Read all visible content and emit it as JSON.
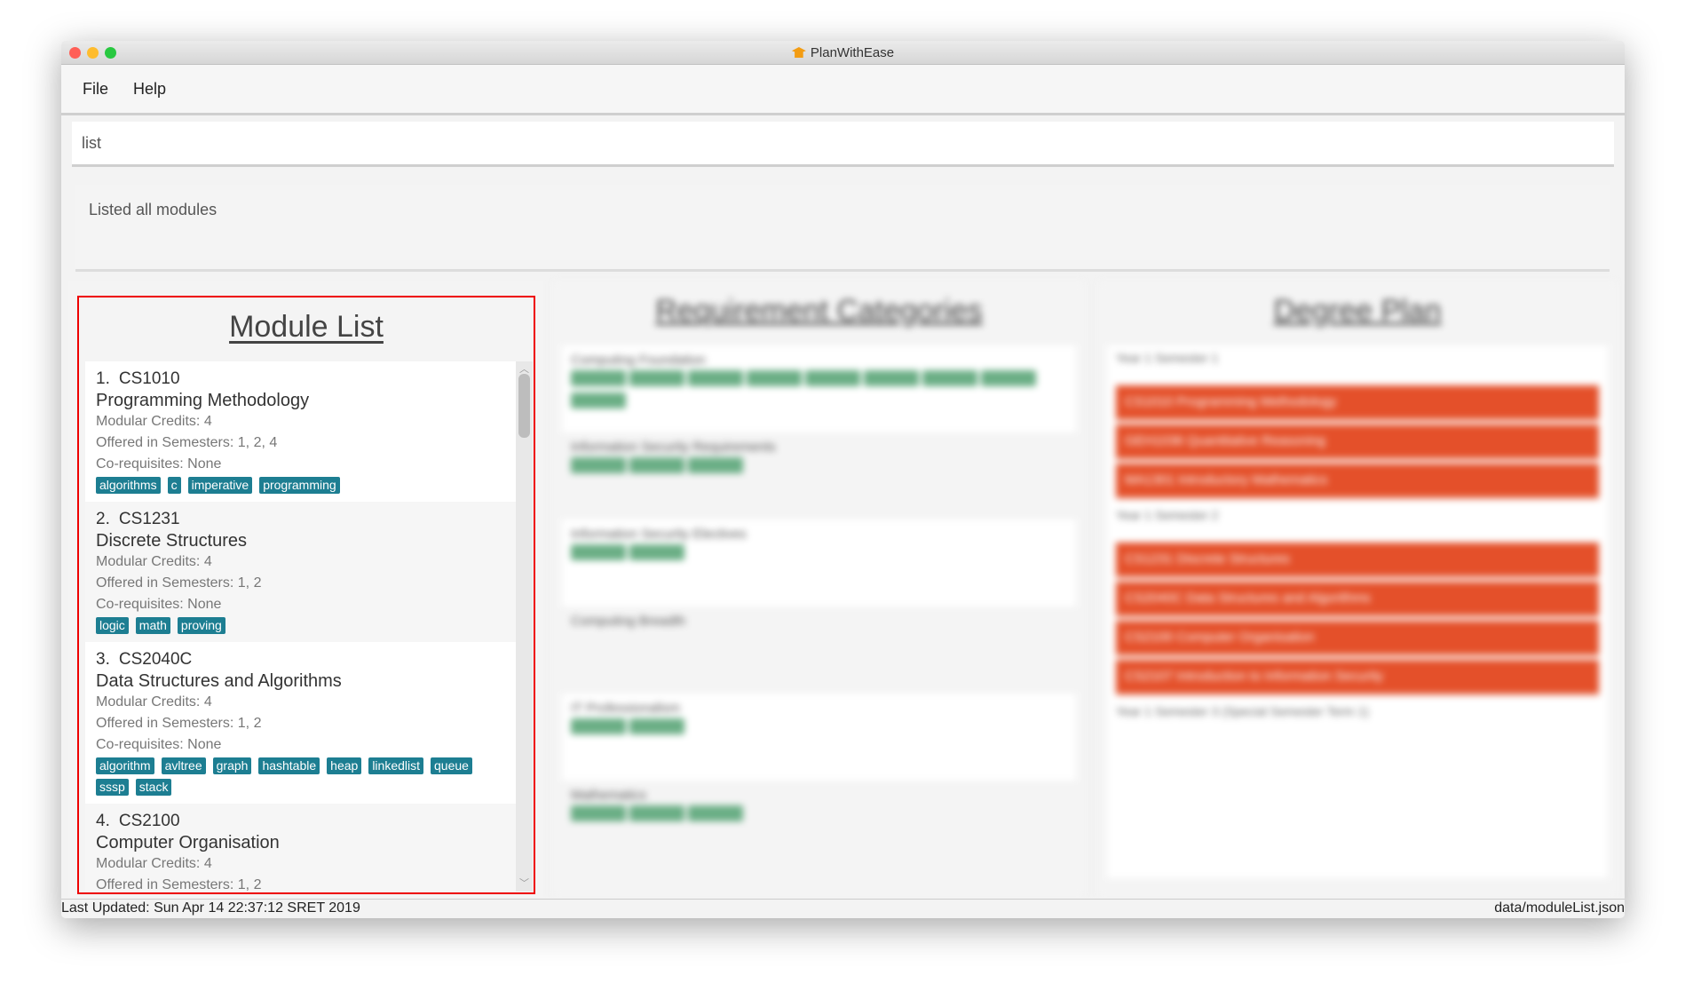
{
  "window": {
    "title": "PlanWithEase",
    "icon": "graduation-cap-icon",
    "controls": {
      "close": "#ff5f57",
      "minimize": "#febc2e",
      "zoom": "#28c840"
    }
  },
  "menu": {
    "items": [
      "File",
      "Help"
    ]
  },
  "command": {
    "value": "list"
  },
  "result": {
    "text": "Listed all modules"
  },
  "module_list": {
    "title": "Module List",
    "modules": [
      {
        "index": "1.",
        "code": "CS1010",
        "name": "Programming Methodology",
        "credits": "Modular Credits: 4",
        "semesters": "Offered in Semesters: 1, 2, 4",
        "coreqs": "Co-requisites: None",
        "tags": [
          "algorithms",
          "c",
          "imperative",
          "programming"
        ]
      },
      {
        "index": "2.",
        "code": "CS1231",
        "name": "Discrete Structures",
        "credits": "Modular Credits: 4",
        "semesters": "Offered in Semesters: 1, 2",
        "coreqs": "Co-requisites: None",
        "tags": [
          "logic",
          "math",
          "proving"
        ]
      },
      {
        "index": "3.",
        "code": "CS2040C",
        "name": "Data Structures and Algorithms",
        "credits": "Modular Credits: 4",
        "semesters": "Offered in Semesters: 1, 2",
        "coreqs": "Co-requisites: None",
        "tags": [
          "algorithm",
          "avltree",
          "graph",
          "hashtable",
          "heap",
          "linkedlist",
          "queue",
          "sssp",
          "stack"
        ]
      },
      {
        "index": "4.",
        "code": "CS2100",
        "name": "Computer Organisation",
        "credits": "Modular Credits: 4",
        "semesters": "Offered in Semesters: 1, 2",
        "coreqs": "",
        "tags": []
      }
    ]
  },
  "requirements": {
    "title": "Requirement Categories",
    "categories": [
      {
        "name": "Computing Foundation",
        "tags": 9
      },
      {
        "name": "Information Security Requirements",
        "tags": 3
      },
      {
        "name": "Information Security Electives",
        "tags": 2
      },
      {
        "name": "Computing Breadth",
        "tags": 0
      },
      {
        "name": "IT Professionalism",
        "tags": 2
      },
      {
        "name": "Mathematics",
        "tags": 3
      }
    ]
  },
  "degree_plan": {
    "title": "Degree Plan",
    "semesters": [
      {
        "label": "Year 1 Semester 1",
        "modules": [
          "CS1010 Programming Methodology",
          "GEH1036 Quantitative Reasoning",
          "MA1301 Introductory Mathematics"
        ]
      },
      {
        "label": "Year 1 Semester 2",
        "modules": [
          "CS1231 Discrete Structures",
          "CS2040C Data Structures and Algorithms",
          "CS2100 Computer Organisation",
          "CS2107 Introduction to Information Security"
        ]
      },
      {
        "label": "Year 1 Semester 3 (Special Semester Term 1)",
        "modules": []
      }
    ]
  },
  "status": {
    "last_updated": "Last Updated: Sun Apr 14 22:37:12 SRET 2019",
    "file": "data/moduleList.json"
  },
  "colors": {
    "tag": "#1d7e92",
    "plan_module": "#e4502a",
    "highlight_border": "#e00000"
  }
}
